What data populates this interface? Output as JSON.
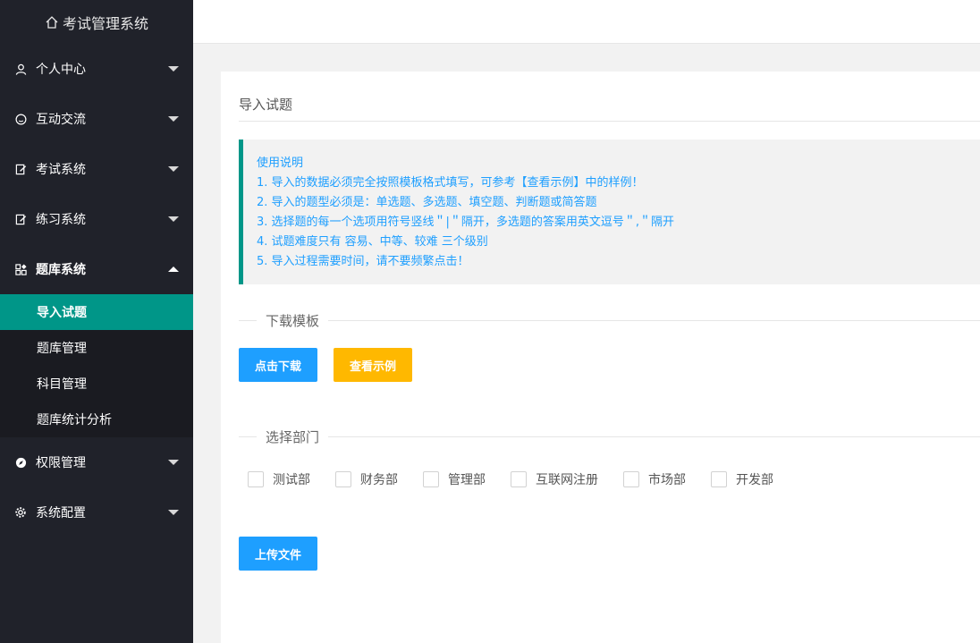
{
  "app": {
    "title": "考试管理系统"
  },
  "sidebar": {
    "items": [
      {
        "label": "个人中心",
        "icon": "user-icon"
      },
      {
        "label": "互动交流",
        "icon": "smile-icon"
      },
      {
        "label": "考试系统",
        "icon": "edit-icon"
      },
      {
        "label": "练习系统",
        "icon": "edit-icon"
      },
      {
        "label": "题库系统",
        "icon": "apps-icon"
      },
      {
        "label": "权限管理",
        "icon": "compass-icon"
      },
      {
        "label": "系统配置",
        "icon": "gear-icon"
      }
    ],
    "subitems": [
      {
        "label": "导入试题",
        "active": true
      },
      {
        "label": "题库管理"
      },
      {
        "label": "科目管理"
      },
      {
        "label": "题库统计分析"
      }
    ]
  },
  "main": {
    "title": "导入试题",
    "notice": [
      "使用说明",
      "1. 导入的数据必须完全按照模板格式填写，可参考【查看示例】中的样例！",
      "2. 导入的题型必须是：单选题、多选题、填空题、判断题或简答题",
      "3. 选择题的每一个选项用符号竖线＂|＂隔开，多选题的答案用英文逗号＂,＂隔开",
      "4. 试题难度只有 容易、中等、较难 三个级别",
      "5. 导入过程需要时间，请不要频繁点击！"
    ],
    "download_section": "下载模板",
    "download_button": "点击下载",
    "example_button": "查看示例",
    "department_section": "选择部门",
    "departments": [
      "测试部",
      "财务部",
      "管理部",
      "互联网注册",
      "市场部",
      "开发部"
    ],
    "upload_button": "上传文件"
  },
  "colors": {
    "sidebar_bg": "#20222a",
    "active": "#009688",
    "primary": "#1e9fff",
    "warning": "#ffb800"
  }
}
